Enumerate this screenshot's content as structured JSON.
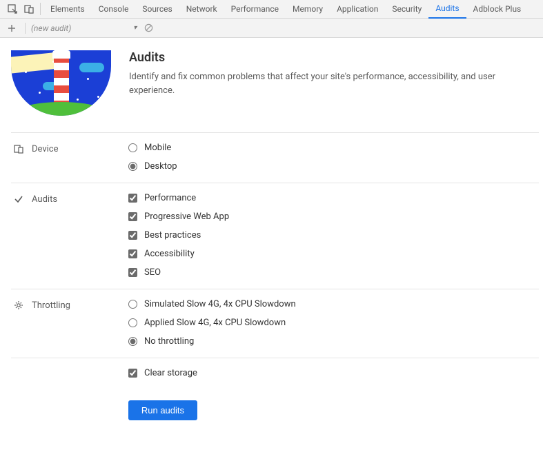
{
  "tabstrip": {
    "tabs": [
      "Elements",
      "Console",
      "Sources",
      "Network",
      "Performance",
      "Memory",
      "Application",
      "Security",
      "Audits",
      "Adblock Plus"
    ],
    "active_index": 8
  },
  "subtoolbar": {
    "dropdown_label": "(new audit)"
  },
  "hero": {
    "title": "Audits",
    "subtitle": "Identify and fix common problems that affect your site's performance, accessibility, and user experience."
  },
  "sections": {
    "device": {
      "label": "Device",
      "options": [
        {
          "label": "Mobile",
          "checked": false
        },
        {
          "label": "Desktop",
          "checked": true
        }
      ]
    },
    "audits": {
      "label": "Audits",
      "options": [
        {
          "label": "Performance",
          "checked": true
        },
        {
          "label": "Progressive Web App",
          "checked": true
        },
        {
          "label": "Best practices",
          "checked": true
        },
        {
          "label": "Accessibility",
          "checked": true
        },
        {
          "label": "SEO",
          "checked": true
        }
      ]
    },
    "throttling": {
      "label": "Throttling",
      "options": [
        {
          "label": "Simulated Slow 4G, 4x CPU Slowdown",
          "checked": false
        },
        {
          "label": "Applied Slow 4G, 4x CPU Slowdown",
          "checked": false
        },
        {
          "label": "No throttling",
          "checked": true
        }
      ]
    },
    "storage": {
      "clear_label": "Clear storage",
      "clear_checked": true
    }
  },
  "run_button_label": "Run audits"
}
